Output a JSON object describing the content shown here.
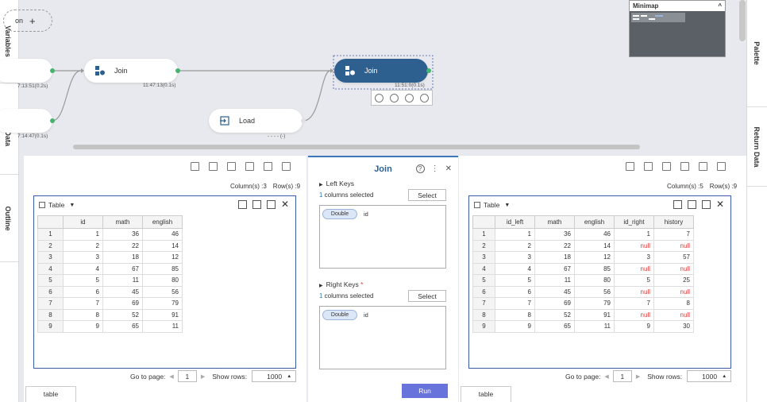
{
  "left_rail": {
    "tabs": [
      "Variables",
      "Input Data",
      "Outline"
    ]
  },
  "right_rail": {
    "tabs": [
      "Palette",
      "Return Data"
    ]
  },
  "canvas": {
    "partial_node_label": "on",
    "add_symbol": "+",
    "nodes": [
      {
        "label": "",
        "time": "7:13:51(0.2s)",
        "icon": "partial-node"
      },
      {
        "label": "Join",
        "time": "11:47:13(0.1s)",
        "icon": "join-icon"
      },
      {
        "label": "Join",
        "time": "11:51:0(0.1s)",
        "icon": "join-icon",
        "active": true
      },
      {
        "label": "",
        "time": "7:14:47(0.1s)",
        "icon": "partial-node"
      },
      {
        "label": "Load",
        "time": "- - - - (-)",
        "icon": "load-icon"
      }
    ],
    "minimap_title": "Minimap",
    "minimap_collapse": "^"
  },
  "left_panel": {
    "columns_text": "Column(s) :3",
    "rows_text": "Row(s) :9",
    "view_label": "Table",
    "headers": [
      "",
      "id",
      "math",
      "english"
    ],
    "rows": [
      [
        "1",
        "1",
        "36",
        "46"
      ],
      [
        "2",
        "2",
        "22",
        "14"
      ],
      [
        "3",
        "3",
        "18",
        "12"
      ],
      [
        "4",
        "4",
        "67",
        "85"
      ],
      [
        "5",
        "5",
        "11",
        "80"
      ],
      [
        "6",
        "6",
        "45",
        "56"
      ],
      [
        "7",
        "7",
        "69",
        "79"
      ],
      [
        "8",
        "8",
        "52",
        "91"
      ],
      [
        "9",
        "9",
        "65",
        "11"
      ]
    ],
    "go_to_page": "Go to page:",
    "page": "1",
    "show_rows": "Show rows:",
    "rows_per_page": "1000",
    "bottom_tab": "table"
  },
  "right_panel": {
    "columns_text": "Column(s) :5",
    "rows_text": "Row(s) :9",
    "view_label": "Table",
    "headers": [
      "",
      "id_left",
      "math",
      "english",
      "id_right",
      "history"
    ],
    "rows": [
      [
        "1",
        "1",
        "36",
        "46",
        "1",
        "7"
      ],
      [
        "2",
        "2",
        "22",
        "14",
        "null",
        "null"
      ],
      [
        "3",
        "3",
        "18",
        "12",
        "3",
        "57"
      ],
      [
        "4",
        "4",
        "67",
        "85",
        "null",
        "null"
      ],
      [
        "5",
        "5",
        "11",
        "80",
        "5",
        "25"
      ],
      [
        "6",
        "6",
        "45",
        "56",
        "null",
        "null"
      ],
      [
        "7",
        "7",
        "69",
        "79",
        "7",
        "8"
      ],
      [
        "8",
        "8",
        "52",
        "91",
        "null",
        "null"
      ],
      [
        "9",
        "9",
        "65",
        "11",
        "9",
        "30"
      ]
    ],
    "go_to_page": "Go to page:",
    "page": "1",
    "show_rows": "Show rows:",
    "rows_per_page": "1000",
    "bottom_tab": "table"
  },
  "dialog": {
    "title": "Join",
    "help": "?",
    "more": "⋮",
    "close": "✕",
    "left_keys": {
      "title": "Left Keys",
      "count": "1",
      "count_suffix": " columns selected",
      "select_label": "Select",
      "key_type": "Double",
      "key_name": "id"
    },
    "right_keys": {
      "title": "Right Keys",
      "required": "*",
      "count": "1",
      "count_suffix": " columns selected",
      "select_label": "Select",
      "key_type": "Double",
      "key_name": "id"
    },
    "run_label": "Run"
  },
  "colors": {
    "accent": "#2d5f8f",
    "run": "#6874db",
    "null": "#e23b3b",
    "status_dot": "#44b36d"
  }
}
